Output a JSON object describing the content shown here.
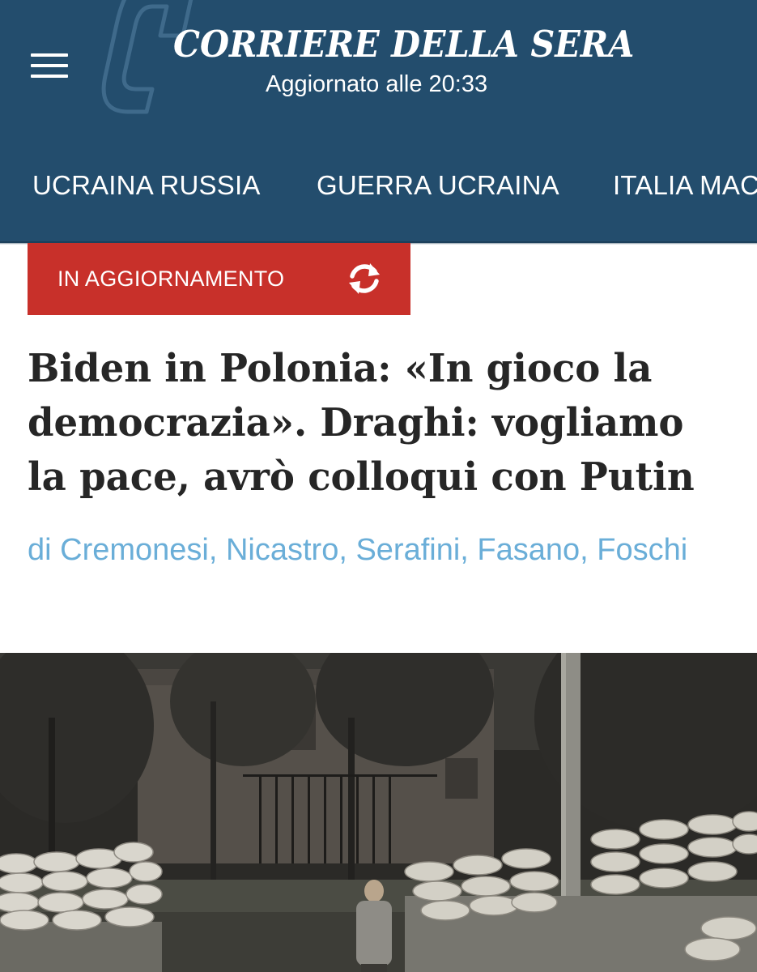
{
  "header": {
    "masthead": "CORRIERE DELLA SERA",
    "updated": "Aggiornato alle 20:33",
    "menu_icon": "hamburger-menu-icon",
    "logo_icon": "corriere-c-logo",
    "background_color": "#234d6d"
  },
  "nav": {
    "items": [
      {
        "label": "UCRAINA RUSSIA"
      },
      {
        "label": "GUERRA UCRAINA"
      },
      {
        "label": "ITALIA MAC"
      }
    ]
  },
  "live_badge": {
    "label": "IN AGGIORNAMENTO",
    "icon": "refresh-icon",
    "color": "#c8302a"
  },
  "article": {
    "headline": "Biden in Polonia: «In gioco la democrazia». Draghi: vogliamo la pace, avrò colloqui con Putin",
    "authors": "di Cremonesi, Nicastro, Serafini, Fasano, Foschi",
    "author_color": "#6aaed8",
    "image": "news-photo"
  }
}
